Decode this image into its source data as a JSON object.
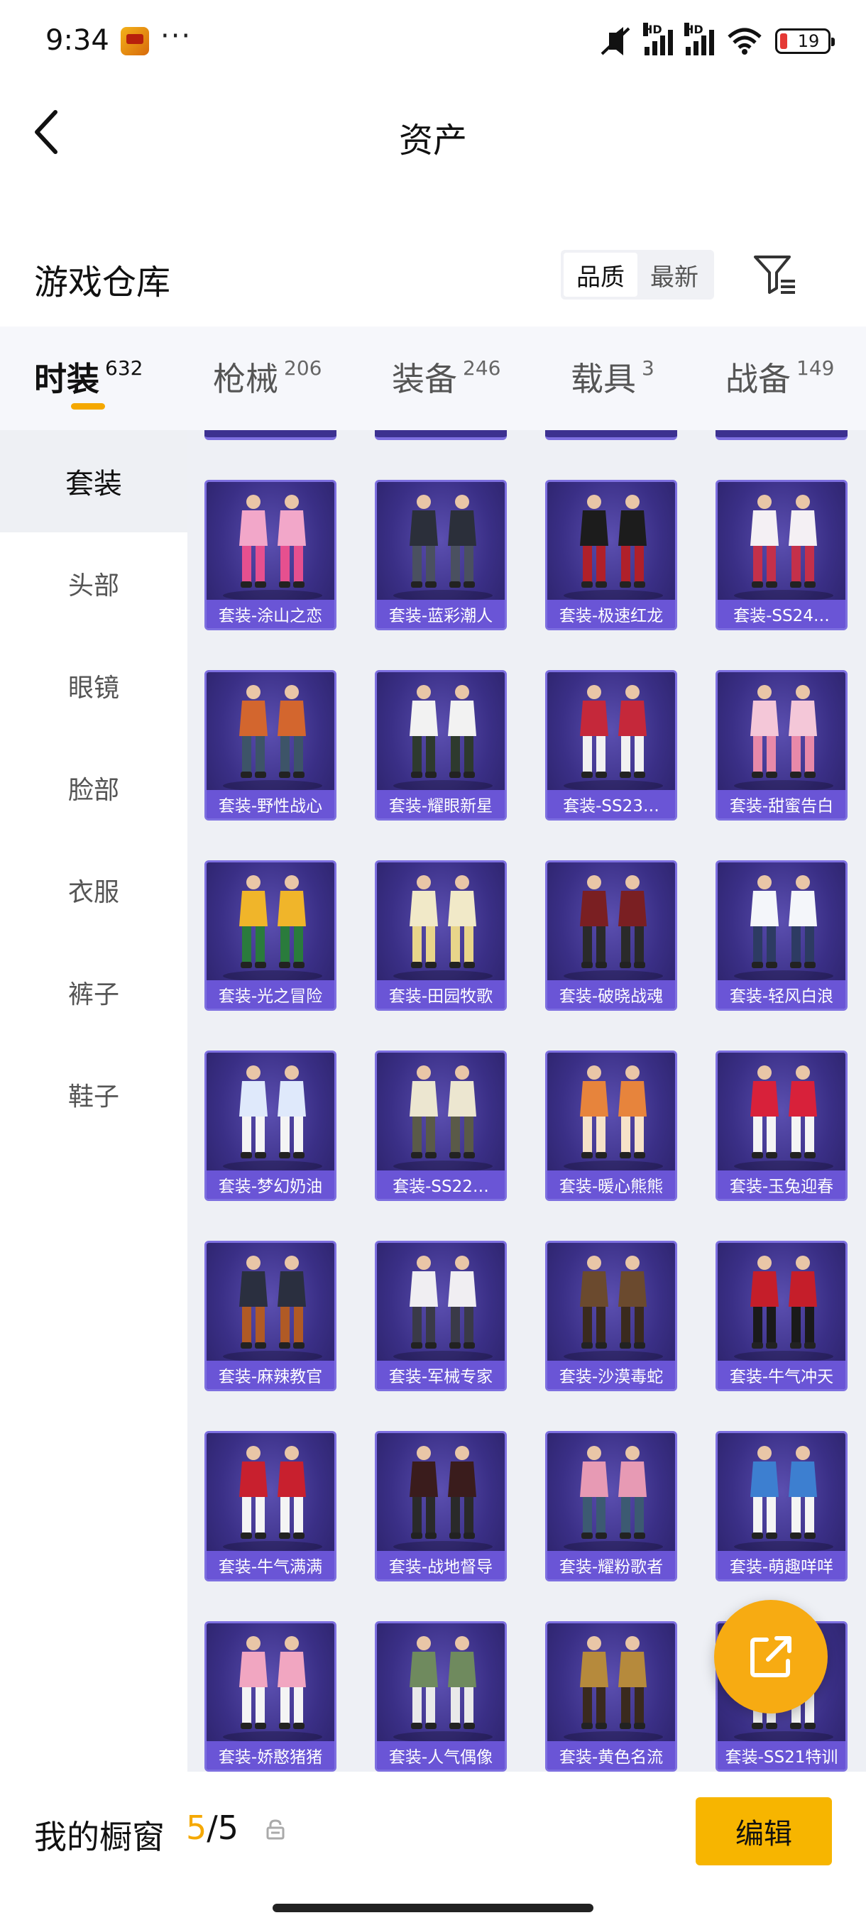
{
  "status_bar": {
    "time": "9:34",
    "dots": "···",
    "battery": "19",
    "signal_label": "HD"
  },
  "header": {
    "title": "资产"
  },
  "warehouse": {
    "title": "游戏仓库",
    "sort_options": [
      "品质",
      "最新"
    ],
    "active_sort": "品质"
  },
  "tabs": [
    {
      "label": "时装",
      "count": "632",
      "active": true
    },
    {
      "label": "枪械",
      "count": "206",
      "active": false
    },
    {
      "label": "装备",
      "count": "246",
      "active": false
    },
    {
      "label": "载具",
      "count": "3",
      "active": false
    },
    {
      "label": "战备",
      "count": "149",
      "active": false
    }
  ],
  "sidebar": {
    "items": [
      {
        "label": "套装",
        "active": true
      },
      {
        "label": "头部",
        "active": false
      },
      {
        "label": "眼镜",
        "active": false
      },
      {
        "label": "脸部",
        "active": false
      },
      {
        "label": "衣服",
        "active": false
      },
      {
        "label": "裤子",
        "active": false
      },
      {
        "label": "鞋子",
        "active": false
      }
    ]
  },
  "items": [
    {
      "label": "套装-涂山之恋",
      "palette": [
        "#f2a7c9",
        "#e6508f"
      ]
    },
    {
      "label": "套装-蓝彩潮人",
      "palette": [
        "#2b2f3a",
        "#4a5060"
      ]
    },
    {
      "label": "套装-极速红龙",
      "palette": [
        "#1c1c1c",
        "#b0202a"
      ]
    },
    {
      "label": "套装-SS24…",
      "palette": [
        "#f4f0f4",
        "#c4304a"
      ]
    },
    {
      "label": "套装-野性战心",
      "palette": [
        "#d3662e",
        "#3d5468"
      ]
    },
    {
      "label": "套装-耀眼新星",
      "palette": [
        "#f2f2f2",
        "#2e3a2e"
      ]
    },
    {
      "label": "套装-SS23…",
      "palette": [
        "#c5283a",
        "#f1f1f1"
      ]
    },
    {
      "label": "套装-甜蜜告白",
      "palette": [
        "#f4c7d8",
        "#e889a9"
      ]
    },
    {
      "label": "套装-光之冒险",
      "palette": [
        "#f0b52a",
        "#2a7b3c"
      ]
    },
    {
      "label": "套装-田园牧歌",
      "palette": [
        "#f1e9c8",
        "#e8d58a"
      ]
    },
    {
      "label": "套装-破晓战魂",
      "palette": [
        "#7a1f22",
        "#2a2a2a"
      ]
    },
    {
      "label": "套装-轻风白浪",
      "palette": [
        "#f4f6fa",
        "#2d3b63"
      ]
    },
    {
      "label": "套装-梦幻奶油",
      "palette": [
        "#dfe9fb",
        "#f4f4f4"
      ]
    },
    {
      "label": "套装-SS22…",
      "palette": [
        "#ece6d0",
        "#5a5a48"
      ]
    },
    {
      "label": "套装-暖心熊熊",
      "palette": [
        "#e7843c",
        "#f6e2c8"
      ]
    },
    {
      "label": "套装-玉兔迎春",
      "palette": [
        "#d8213a",
        "#f4f4f4"
      ]
    },
    {
      "label": "套装-麻辣教官",
      "palette": [
        "#2a2f3f",
        "#b05a25"
      ]
    },
    {
      "label": "套装-军械专家",
      "palette": [
        "#f0eef2",
        "#3a3a48"
      ]
    },
    {
      "label": "套装-沙漠毒蛇",
      "palette": [
        "#6b4a2e",
        "#3a2a1e"
      ]
    },
    {
      "label": "套装-牛气冲天",
      "palette": [
        "#c51e2a",
        "#1a1a1a"
      ]
    },
    {
      "label": "套装-牛气满满",
      "palette": [
        "#c8202e",
        "#f4f4f4"
      ]
    },
    {
      "label": "套装-战地督导",
      "palette": [
        "#3a1c1c",
        "#2a2a2a"
      ]
    },
    {
      "label": "套装-耀粉歌者",
      "palette": [
        "#e79ab4",
        "#3c5a72"
      ]
    },
    {
      "label": "套装-萌趣咩咩",
      "palette": [
        "#3d7fd0",
        "#f4f4f4"
      ]
    },
    {
      "label": "套装-娇憨猪猪",
      "palette": [
        "#f1a6c1",
        "#f4f4f4"
      ]
    },
    {
      "label": "套装-人气偶像",
      "palette": [
        "#6f8a5e",
        "#e9e9e9"
      ]
    },
    {
      "label": "套装-黄色名流",
      "palette": [
        "#b68a3c",
        "#3a2a1e"
      ]
    },
    {
      "label": "套装-SS21特训",
      "palette": [
        "#2d3a52",
        "#f4f4f4"
      ]
    }
  ],
  "bottom": {
    "wardrobe_label": "我的橱窗",
    "current": "5",
    "total": "/5",
    "edit_label": "编辑"
  },
  "colors": {
    "accent": "#f5a800",
    "card_bg": "#3a2f86",
    "card_footer": "#6a55d6"
  }
}
